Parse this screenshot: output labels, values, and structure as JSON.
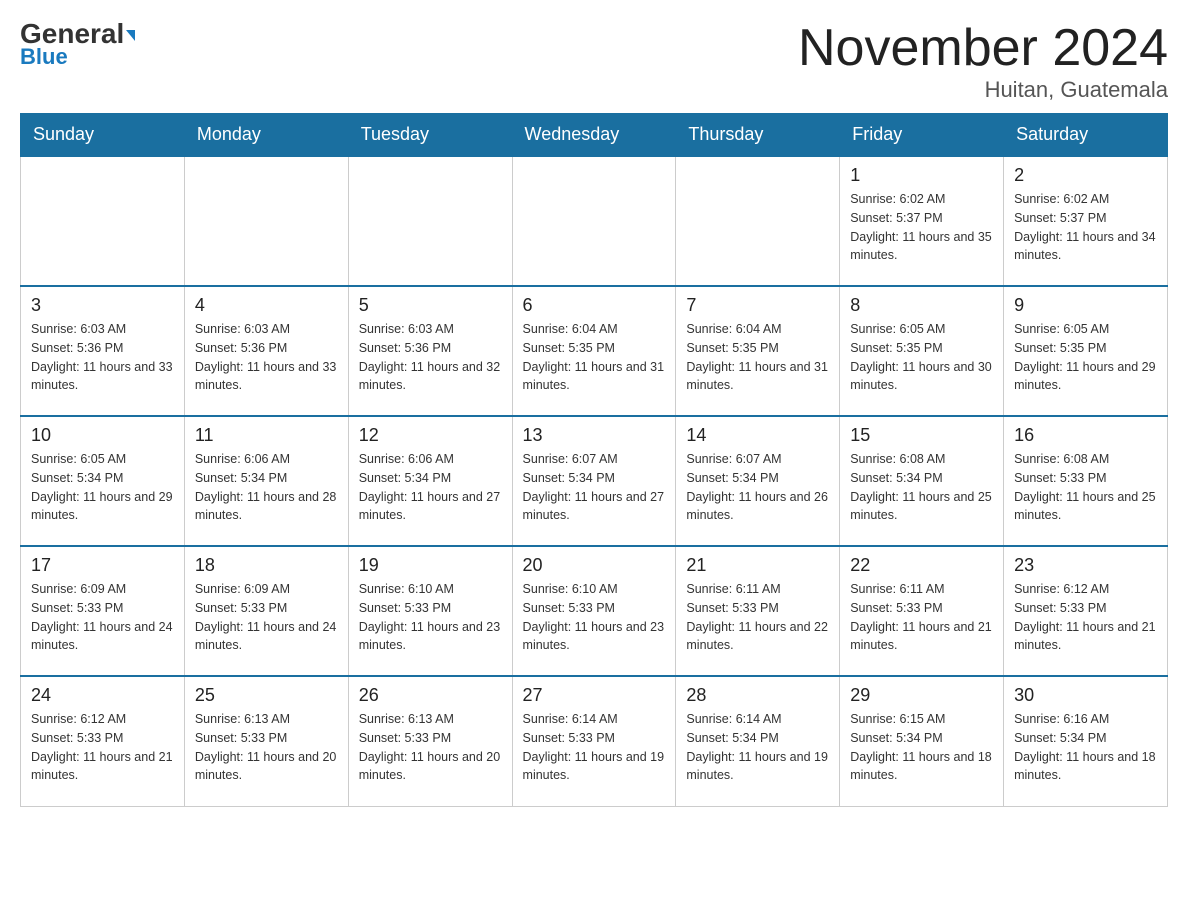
{
  "header": {
    "logo_general": "General",
    "logo_blue": "Blue",
    "month_year": "November 2024",
    "location": "Huitan, Guatemala"
  },
  "days_of_week": [
    "Sunday",
    "Monday",
    "Tuesday",
    "Wednesday",
    "Thursday",
    "Friday",
    "Saturday"
  ],
  "weeks": [
    [
      {
        "day": "",
        "info": ""
      },
      {
        "day": "",
        "info": ""
      },
      {
        "day": "",
        "info": ""
      },
      {
        "day": "",
        "info": ""
      },
      {
        "day": "",
        "info": ""
      },
      {
        "day": "1",
        "info": "Sunrise: 6:02 AM\nSunset: 5:37 PM\nDaylight: 11 hours and 35 minutes."
      },
      {
        "day": "2",
        "info": "Sunrise: 6:02 AM\nSunset: 5:37 PM\nDaylight: 11 hours and 34 minutes."
      }
    ],
    [
      {
        "day": "3",
        "info": "Sunrise: 6:03 AM\nSunset: 5:36 PM\nDaylight: 11 hours and 33 minutes."
      },
      {
        "day": "4",
        "info": "Sunrise: 6:03 AM\nSunset: 5:36 PM\nDaylight: 11 hours and 33 minutes."
      },
      {
        "day": "5",
        "info": "Sunrise: 6:03 AM\nSunset: 5:36 PM\nDaylight: 11 hours and 32 minutes."
      },
      {
        "day": "6",
        "info": "Sunrise: 6:04 AM\nSunset: 5:35 PM\nDaylight: 11 hours and 31 minutes."
      },
      {
        "day": "7",
        "info": "Sunrise: 6:04 AM\nSunset: 5:35 PM\nDaylight: 11 hours and 31 minutes."
      },
      {
        "day": "8",
        "info": "Sunrise: 6:05 AM\nSunset: 5:35 PM\nDaylight: 11 hours and 30 minutes."
      },
      {
        "day": "9",
        "info": "Sunrise: 6:05 AM\nSunset: 5:35 PM\nDaylight: 11 hours and 29 minutes."
      }
    ],
    [
      {
        "day": "10",
        "info": "Sunrise: 6:05 AM\nSunset: 5:34 PM\nDaylight: 11 hours and 29 minutes."
      },
      {
        "day": "11",
        "info": "Sunrise: 6:06 AM\nSunset: 5:34 PM\nDaylight: 11 hours and 28 minutes."
      },
      {
        "day": "12",
        "info": "Sunrise: 6:06 AM\nSunset: 5:34 PM\nDaylight: 11 hours and 27 minutes."
      },
      {
        "day": "13",
        "info": "Sunrise: 6:07 AM\nSunset: 5:34 PM\nDaylight: 11 hours and 27 minutes."
      },
      {
        "day": "14",
        "info": "Sunrise: 6:07 AM\nSunset: 5:34 PM\nDaylight: 11 hours and 26 minutes."
      },
      {
        "day": "15",
        "info": "Sunrise: 6:08 AM\nSunset: 5:34 PM\nDaylight: 11 hours and 25 minutes."
      },
      {
        "day": "16",
        "info": "Sunrise: 6:08 AM\nSunset: 5:33 PM\nDaylight: 11 hours and 25 minutes."
      }
    ],
    [
      {
        "day": "17",
        "info": "Sunrise: 6:09 AM\nSunset: 5:33 PM\nDaylight: 11 hours and 24 minutes."
      },
      {
        "day": "18",
        "info": "Sunrise: 6:09 AM\nSunset: 5:33 PM\nDaylight: 11 hours and 24 minutes."
      },
      {
        "day": "19",
        "info": "Sunrise: 6:10 AM\nSunset: 5:33 PM\nDaylight: 11 hours and 23 minutes."
      },
      {
        "day": "20",
        "info": "Sunrise: 6:10 AM\nSunset: 5:33 PM\nDaylight: 11 hours and 23 minutes."
      },
      {
        "day": "21",
        "info": "Sunrise: 6:11 AM\nSunset: 5:33 PM\nDaylight: 11 hours and 22 minutes."
      },
      {
        "day": "22",
        "info": "Sunrise: 6:11 AM\nSunset: 5:33 PM\nDaylight: 11 hours and 21 minutes."
      },
      {
        "day": "23",
        "info": "Sunrise: 6:12 AM\nSunset: 5:33 PM\nDaylight: 11 hours and 21 minutes."
      }
    ],
    [
      {
        "day": "24",
        "info": "Sunrise: 6:12 AM\nSunset: 5:33 PM\nDaylight: 11 hours and 21 minutes."
      },
      {
        "day": "25",
        "info": "Sunrise: 6:13 AM\nSunset: 5:33 PM\nDaylight: 11 hours and 20 minutes."
      },
      {
        "day": "26",
        "info": "Sunrise: 6:13 AM\nSunset: 5:33 PM\nDaylight: 11 hours and 20 minutes."
      },
      {
        "day": "27",
        "info": "Sunrise: 6:14 AM\nSunset: 5:33 PM\nDaylight: 11 hours and 19 minutes."
      },
      {
        "day": "28",
        "info": "Sunrise: 6:14 AM\nSunset: 5:34 PM\nDaylight: 11 hours and 19 minutes."
      },
      {
        "day": "29",
        "info": "Sunrise: 6:15 AM\nSunset: 5:34 PM\nDaylight: 11 hours and 18 minutes."
      },
      {
        "day": "30",
        "info": "Sunrise: 6:16 AM\nSunset: 5:34 PM\nDaylight: 11 hours and 18 minutes."
      }
    ]
  ]
}
